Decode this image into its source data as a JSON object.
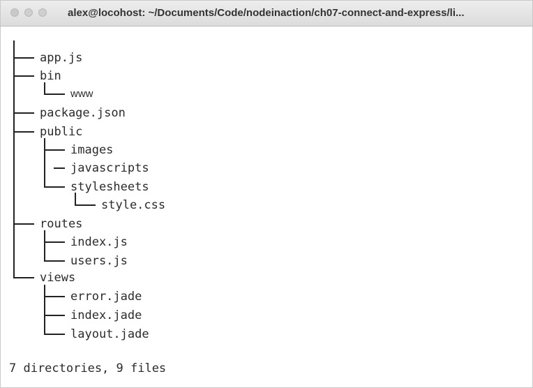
{
  "window": {
    "title": "alex@locohost: ~/Documents/Code/nodeinaction/ch07-connect-and-express/li..."
  },
  "tree": {
    "root": ".",
    "entries": [
      "app.js",
      "bin",
      "www",
      "package.json",
      "public",
      "images",
      "javascripts",
      "stylesheets",
      "style.css",
      "routes",
      "index.js",
      "users.js",
      "views",
      "error.jade",
      "index.jade",
      "layout.jade"
    ]
  },
  "summary": "7 directories, 9 files",
  "colors": {
    "text": "#2b2b2b",
    "titlebar": "#e4e4e4",
    "background": "#ffffff"
  }
}
